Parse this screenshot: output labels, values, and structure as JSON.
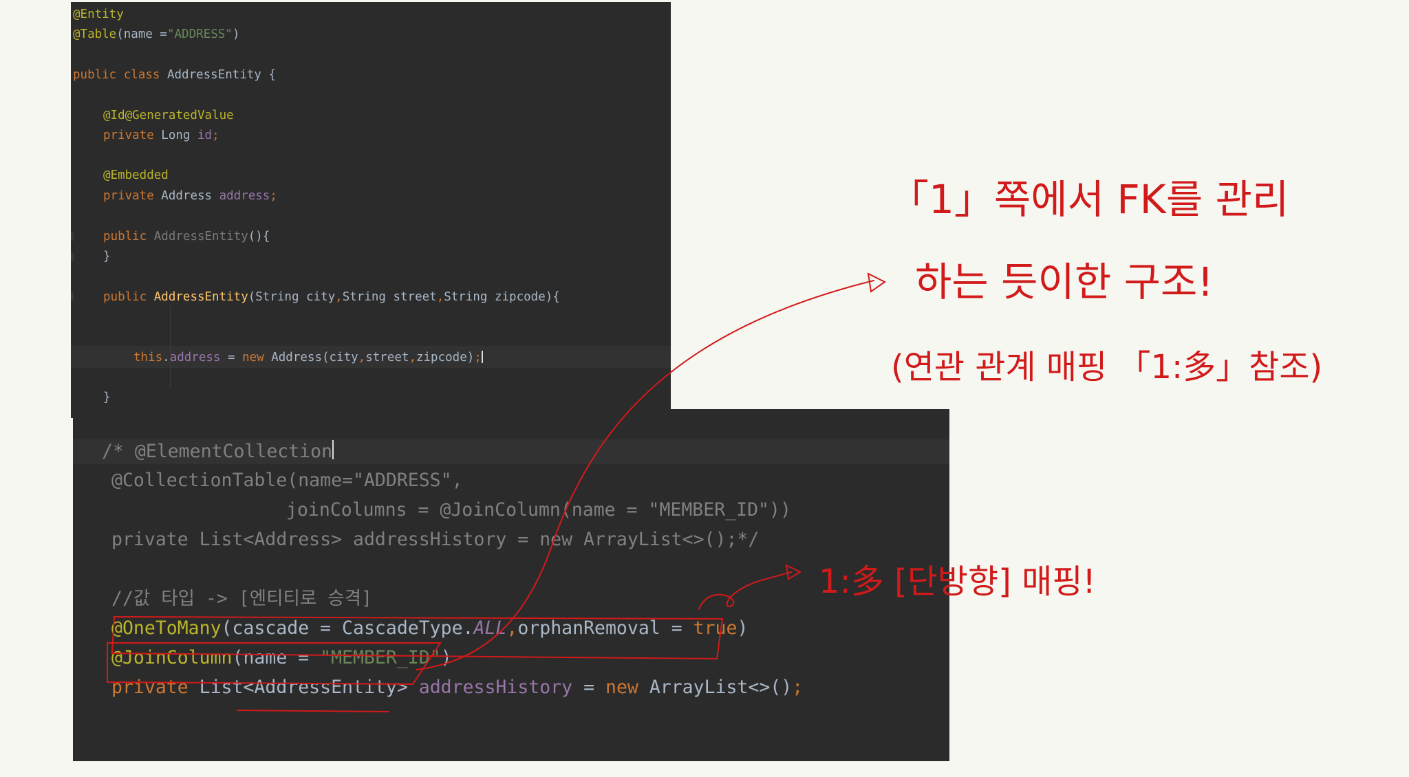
{
  "top_panel": {
    "lines": [
      {
        "segments": [
          {
            "t": "@Entity",
            "c": "ann"
          }
        ]
      },
      {
        "segments": [
          {
            "t": "@Table",
            "c": "ann"
          },
          {
            "t": "(name =",
            "c": "pl"
          },
          {
            "t": "\"ADDRESS\"",
            "c": "str"
          },
          {
            "t": ")",
            "c": "pl"
          }
        ]
      },
      {
        "segments": [
          {
            "t": "public class ",
            "c": "kw"
          },
          {
            "t": "AddressEntity {",
            "c": "pl"
          }
        ]
      },
      {
        "segments": [
          {
            "t": "@Id@GeneratedValue",
            "c": "ann"
          }
        ]
      },
      {
        "segments": [
          {
            "t": "private ",
            "c": "kw"
          },
          {
            "t": "Long ",
            "c": "pl"
          },
          {
            "t": "id",
            "c": "fld"
          },
          {
            "t": ";",
            "c": "kw"
          }
        ]
      },
      {
        "segments": [
          {
            "t": "@Embedded",
            "c": "ann"
          }
        ]
      },
      {
        "segments": [
          {
            "t": "private ",
            "c": "kw"
          },
          {
            "t": "Address ",
            "c": "pl"
          },
          {
            "t": "address",
            "c": "fld"
          },
          {
            "t": ";",
            "c": "kw"
          }
        ]
      },
      {
        "segments": [
          {
            "t": "public ",
            "c": "kw"
          },
          {
            "t": "AddressEntity",
            "c": "unused"
          },
          {
            "t": "(){",
            "c": "pl"
          }
        ]
      },
      {
        "segments": [
          {
            "t": "}",
            "c": "pl"
          }
        ]
      },
      {
        "segments": [
          {
            "t": "public ",
            "c": "kw"
          },
          {
            "t": "AddressEntity",
            "c": "fn"
          },
          {
            "t": "(String city",
            "c": "pl"
          },
          {
            "t": ",",
            "c": "kw"
          },
          {
            "t": "String street",
            "c": "pl"
          },
          {
            "t": ",",
            "c": "kw"
          },
          {
            "t": "String zipcode){",
            "c": "pl"
          }
        ]
      },
      {
        "segments": [
          {
            "t": "this",
            "c": "kw"
          },
          {
            "t": ".",
            "c": "pl"
          },
          {
            "t": "address",
            "c": "fld"
          },
          {
            "t": " = ",
            "c": "pl"
          },
          {
            "t": "new ",
            "c": "kw"
          },
          {
            "t": "Address(city",
            "c": "pl"
          },
          {
            "t": ",",
            "c": "kw"
          },
          {
            "t": "street",
            "c": "pl"
          },
          {
            "t": ",",
            "c": "kw"
          },
          {
            "t": "zipcode)",
            "c": "pl"
          },
          {
            "t": ";",
            "c": "kw"
          }
        ],
        "caret": true
      },
      {
        "segments": [
          {
            "t": "}",
            "c": "pl"
          }
        ]
      }
    ]
  },
  "bottom_panel": {
    "lines": [
      {
        "segments": [
          {
            "t": "/* @ElementCollection",
            "c": "gray"
          }
        ],
        "caret": true
      },
      {
        "segments": [
          {
            "t": "@CollectionTable(name=\"ADDRESS\",",
            "c": "gray"
          }
        ]
      },
      {
        "segments": [
          {
            "t": "joinColumns = @JoinColumn(name = \"MEMBER_ID\"))",
            "c": "gray"
          }
        ]
      },
      {
        "segments": [
          {
            "t": "private List<Address> addressHistory = new ArrayList<>();*/",
            "c": "gray"
          }
        ]
      },
      {
        "segments": [
          {
            "t": "//값 타입 -> [엔티티로 승격]",
            "c": "gray"
          }
        ]
      },
      {
        "segments": [
          {
            "t": "@OneToMany",
            "c": "ann"
          },
          {
            "t": "(cascade = CascadeType.",
            "c": "pl"
          },
          {
            "t": "ALL",
            "c": "fld it"
          },
          {
            "t": ",",
            "c": "kw"
          },
          {
            "t": "orphanRemoval = ",
            "c": "pl"
          },
          {
            "t": "true",
            "c": "kw"
          },
          {
            "t": ")",
            "c": "pl"
          }
        ]
      },
      {
        "segments": [
          {
            "t": "@JoinColumn",
            "c": "ann"
          },
          {
            "t": "(name = ",
            "c": "pl"
          },
          {
            "t": "\"MEMBER_ID\"",
            "c": "str"
          },
          {
            "t": ")",
            "c": "pl"
          }
        ]
      },
      {
        "segments": [
          {
            "t": "private ",
            "c": "kw"
          },
          {
            "t": "List<AddressEntity> ",
            "c": "pl"
          },
          {
            "t": "addressHistory",
            "c": "fld"
          },
          {
            "t": " = ",
            "c": "pl"
          },
          {
            "t": "new ",
            "c": "kw"
          },
          {
            "t": "ArrayList<>()",
            "c": "pl"
          },
          {
            "t": ";",
            "c": "kw"
          }
        ]
      }
    ]
  },
  "annotations": {
    "note_line_1": "「1」쪽에서 FK를 관리",
    "note_line_2": "하는 듯이한 구조!",
    "note_line_3": "(연관 관계 매핑 「1:多」참조)",
    "note_arrow": "1:多 [단방향] 매핑!",
    "color": "#d11a1a"
  }
}
